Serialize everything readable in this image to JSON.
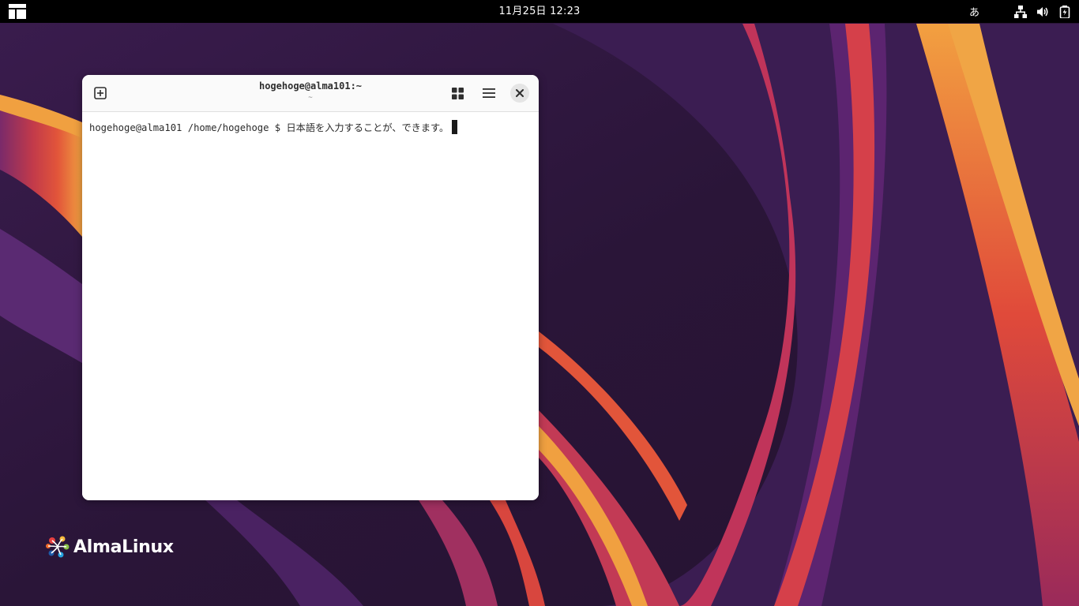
{
  "topbar": {
    "clock": "11月25日 12:23",
    "input_method": "あ",
    "icons": [
      "activities-icon",
      "network-icon",
      "volume-icon",
      "battery-icon"
    ]
  },
  "terminal": {
    "title": "hogehoge@alma101:~",
    "subtitle": "~",
    "prompt": "hogehoge@alma101 /home/hogehoge $ ",
    "input_text": "日本語を入力することが、できます。",
    "header_icons": [
      "new-tab-icon",
      "tab-overview-icon",
      "hamburger-menu-icon",
      "close-icon"
    ]
  },
  "desktop": {
    "logo_text": "AlmaLinux"
  },
  "colors": {
    "topbar_bg": "#000000",
    "wallpaper_base": "#2a1535",
    "terminal_bg": "#ffffff"
  }
}
